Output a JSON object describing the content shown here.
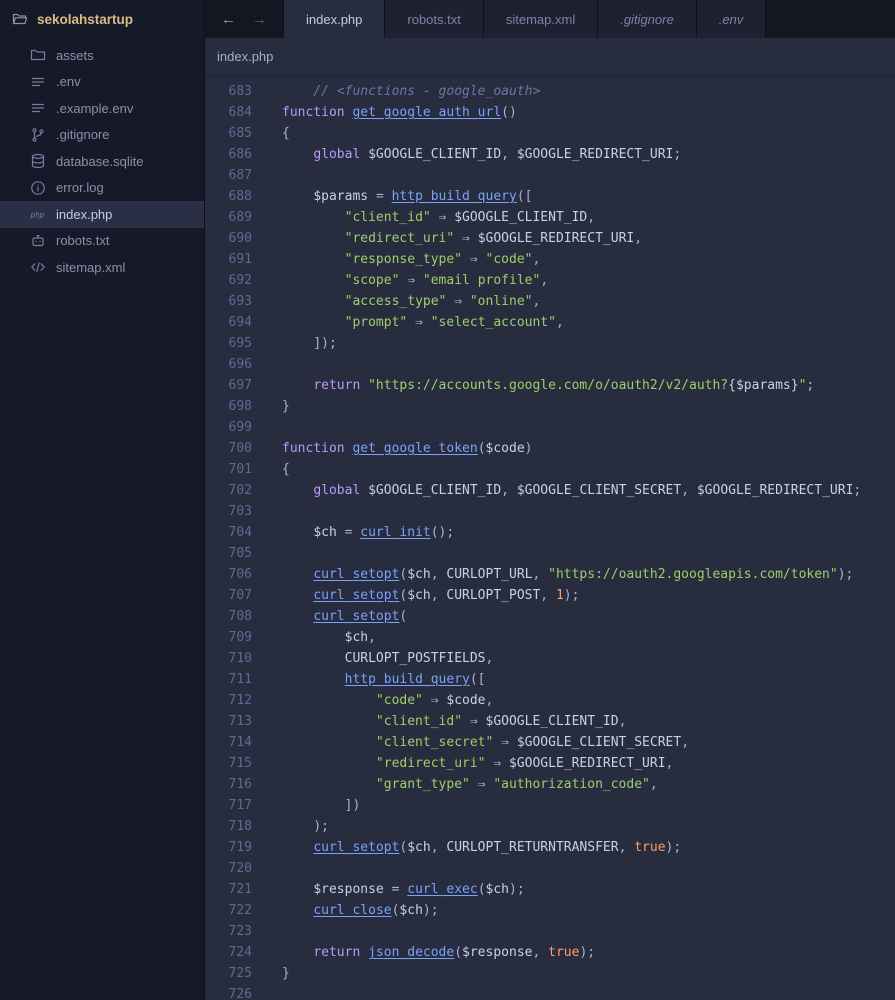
{
  "workspace": {
    "name": "sekolahstartup"
  },
  "sidebar": {
    "files": [
      {
        "name": "assets",
        "icon": "folder"
      },
      {
        "name": ".env",
        "icon": "list"
      },
      {
        "name": ".example.env",
        "icon": "list"
      },
      {
        "name": ".gitignore",
        "icon": "git-branch"
      },
      {
        "name": "database.sqlite",
        "icon": "database"
      },
      {
        "name": "error.log",
        "icon": "info"
      },
      {
        "name": "index.php",
        "icon": "php",
        "selected": true
      },
      {
        "name": "robots.txt",
        "icon": "robot"
      },
      {
        "name": "sitemap.xml",
        "icon": "code"
      }
    ]
  },
  "tabbar": {
    "back": "←",
    "forward": "→",
    "tabs": [
      {
        "label": "index.php",
        "active": true
      },
      {
        "label": "robots.txt"
      },
      {
        "label": "sitemap.xml"
      },
      {
        "label": ".gitignore",
        "italic": true
      },
      {
        "label": ".env",
        "italic": true
      }
    ]
  },
  "breadcrumb": {
    "path": "index.php"
  },
  "colors": {
    "editor_bg": "#272c3f",
    "sidebar_bg": "#161a28",
    "tabbar_bg": "#141722",
    "tab_inactive_bg": "#1d2130",
    "selected_file_bg": "#2a2f45",
    "keyword": "#bb9af7",
    "function": "#7aa2f7",
    "string": "#9ece6a",
    "variable": "#c9cfe9",
    "comment": "#6d75a3",
    "punctuation": "#a9b1d6",
    "number": "#ff9e64",
    "boolean": "#ff9e64",
    "arrow": "#b6bedd",
    "line_number": "#5f6a94",
    "accent_folder": "#d9bd84"
  },
  "editor": {
    "lines": [
      {
        "n": 683,
        "t": [
          [
            "pln",
            "    "
          ],
          [
            "cmt",
            "// <functions - google_oauth>"
          ]
        ]
      },
      {
        "n": 684,
        "t": [
          [
            "kw",
            "function"
          ],
          [
            "pln",
            " "
          ],
          [
            "fn",
            "get_google_auth_url"
          ],
          [
            "pun",
            "()"
          ]
        ]
      },
      {
        "n": 685,
        "t": [
          [
            "pun",
            "{"
          ]
        ]
      },
      {
        "n": 686,
        "t": [
          [
            "pln",
            "    "
          ],
          [
            "kw",
            "global"
          ],
          [
            "pln",
            " "
          ],
          [
            "var",
            "$GOOGLE_CLIENT_ID"
          ],
          [
            "pun",
            ","
          ],
          [
            "pln",
            " "
          ],
          [
            "var",
            "$GOOGLE_REDIRECT_URI"
          ],
          [
            "pun",
            ";"
          ]
        ]
      },
      {
        "n": 687,
        "t": []
      },
      {
        "n": 688,
        "t": [
          [
            "pln",
            "    "
          ],
          [
            "var",
            "$params"
          ],
          [
            "pln",
            " "
          ],
          [
            "pun",
            "="
          ],
          [
            "pln",
            " "
          ],
          [
            "fn",
            "http_build_query"
          ],
          [
            "pun",
            "(["
          ]
        ]
      },
      {
        "n": 689,
        "t": [
          [
            "pln",
            "        "
          ],
          [
            "str",
            "\"client_id\""
          ],
          [
            "pln",
            " "
          ],
          [
            "arr",
            "⇒"
          ],
          [
            "pln",
            " "
          ],
          [
            "var",
            "$GOOGLE_CLIENT_ID"
          ],
          [
            "pun",
            ","
          ]
        ]
      },
      {
        "n": 690,
        "t": [
          [
            "pln",
            "        "
          ],
          [
            "str",
            "\"redirect_uri\""
          ],
          [
            "pln",
            " "
          ],
          [
            "arr",
            "⇒"
          ],
          [
            "pln",
            " "
          ],
          [
            "var",
            "$GOOGLE_REDIRECT_URI"
          ],
          [
            "pun",
            ","
          ]
        ]
      },
      {
        "n": 691,
        "t": [
          [
            "pln",
            "        "
          ],
          [
            "str",
            "\"response_type\""
          ],
          [
            "pln",
            " "
          ],
          [
            "arr",
            "⇒"
          ],
          [
            "pln",
            " "
          ],
          [
            "str",
            "\"code\""
          ],
          [
            "pun",
            ","
          ]
        ]
      },
      {
        "n": 692,
        "t": [
          [
            "pln",
            "        "
          ],
          [
            "str",
            "\"scope\""
          ],
          [
            "pln",
            " "
          ],
          [
            "arr",
            "⇒"
          ],
          [
            "pln",
            " "
          ],
          [
            "str",
            "\"email profile\""
          ],
          [
            "pun",
            ","
          ]
        ]
      },
      {
        "n": 693,
        "t": [
          [
            "pln",
            "        "
          ],
          [
            "str",
            "\"access_type\""
          ],
          [
            "pln",
            " "
          ],
          [
            "arr",
            "⇒"
          ],
          [
            "pln",
            " "
          ],
          [
            "str",
            "\"online\""
          ],
          [
            "pun",
            ","
          ]
        ]
      },
      {
        "n": 694,
        "t": [
          [
            "pln",
            "        "
          ],
          [
            "str",
            "\"prompt\""
          ],
          [
            "pln",
            " "
          ],
          [
            "arr",
            "⇒"
          ],
          [
            "pln",
            " "
          ],
          [
            "str",
            "\"select_account\""
          ],
          [
            "pun",
            ","
          ]
        ]
      },
      {
        "n": 695,
        "t": [
          [
            "pln",
            "    "
          ],
          [
            "pun",
            "]);"
          ]
        ]
      },
      {
        "n": 696,
        "t": []
      },
      {
        "n": 697,
        "t": [
          [
            "pln",
            "    "
          ],
          [
            "kw",
            "return"
          ],
          [
            "pln",
            " "
          ],
          [
            "str",
            "\"https://accounts.google.com/o/oauth2/v2/auth?"
          ],
          [
            "interp",
            "{$params}"
          ],
          [
            "str",
            "\""
          ],
          [
            "pun",
            ";"
          ]
        ]
      },
      {
        "n": 698,
        "t": [
          [
            "pun",
            "}"
          ]
        ]
      },
      {
        "n": 699,
        "t": []
      },
      {
        "n": 700,
        "t": [
          [
            "kw",
            "function"
          ],
          [
            "pln",
            " "
          ],
          [
            "fn",
            "get_google_token"
          ],
          [
            "pun",
            "("
          ],
          [
            "var",
            "$code"
          ],
          [
            "pun",
            ")"
          ]
        ]
      },
      {
        "n": 701,
        "t": [
          [
            "pun",
            "{"
          ]
        ]
      },
      {
        "n": 702,
        "t": [
          [
            "pln",
            "    "
          ],
          [
            "kw",
            "global"
          ],
          [
            "pln",
            " "
          ],
          [
            "var",
            "$GOOGLE_CLIENT_ID"
          ],
          [
            "pun",
            ","
          ],
          [
            "pln",
            " "
          ],
          [
            "var",
            "$GOOGLE_CLIENT_SECRET"
          ],
          [
            "pun",
            ","
          ],
          [
            "pln",
            " "
          ],
          [
            "var",
            "$GOOGLE_REDIRECT_URI"
          ],
          [
            "pun",
            ";"
          ]
        ]
      },
      {
        "n": 703,
        "t": []
      },
      {
        "n": 704,
        "t": [
          [
            "pln",
            "    "
          ],
          [
            "var",
            "$ch"
          ],
          [
            "pln",
            " "
          ],
          [
            "pun",
            "="
          ],
          [
            "pln",
            " "
          ],
          [
            "fn",
            "curl_init"
          ],
          [
            "pun",
            "();"
          ]
        ]
      },
      {
        "n": 705,
        "t": []
      },
      {
        "n": 706,
        "t": [
          [
            "pln",
            "    "
          ],
          [
            "fn",
            "curl_setopt"
          ],
          [
            "pun",
            "("
          ],
          [
            "var",
            "$ch"
          ],
          [
            "pun",
            ","
          ],
          [
            "pln",
            " "
          ],
          [
            "const",
            "CURLOPT_URL"
          ],
          [
            "pun",
            ","
          ],
          [
            "pln",
            " "
          ],
          [
            "str",
            "\"https://oauth2.googleapis.com/token\""
          ],
          [
            "pun",
            ");"
          ]
        ]
      },
      {
        "n": 707,
        "t": [
          [
            "pln",
            "    "
          ],
          [
            "fn",
            "curl_setopt"
          ],
          [
            "pun",
            "("
          ],
          [
            "var",
            "$ch"
          ],
          [
            "pun",
            ","
          ],
          [
            "pln",
            " "
          ],
          [
            "const",
            "CURLOPT_POST"
          ],
          [
            "pun",
            ","
          ],
          [
            "pln",
            " "
          ],
          [
            "num",
            "1"
          ],
          [
            "pun",
            ");"
          ]
        ]
      },
      {
        "n": 708,
        "t": [
          [
            "pln",
            "    "
          ],
          [
            "fn",
            "curl_setopt"
          ],
          [
            "pun",
            "("
          ]
        ]
      },
      {
        "n": 709,
        "t": [
          [
            "pln",
            "        "
          ],
          [
            "var",
            "$ch"
          ],
          [
            "pun",
            ","
          ]
        ]
      },
      {
        "n": 710,
        "t": [
          [
            "pln",
            "        "
          ],
          [
            "const",
            "CURLOPT_POSTFIELDS"
          ],
          [
            "pun",
            ","
          ]
        ]
      },
      {
        "n": 711,
        "t": [
          [
            "pln",
            "        "
          ],
          [
            "fn",
            "http_build_query"
          ],
          [
            "pun",
            "(["
          ]
        ]
      },
      {
        "n": 712,
        "t": [
          [
            "pln",
            "            "
          ],
          [
            "str",
            "\"code\""
          ],
          [
            "pln",
            " "
          ],
          [
            "arr",
            "⇒"
          ],
          [
            "pln",
            " "
          ],
          [
            "var",
            "$code"
          ],
          [
            "pun",
            ","
          ]
        ]
      },
      {
        "n": 713,
        "t": [
          [
            "pln",
            "            "
          ],
          [
            "str",
            "\"client_id\""
          ],
          [
            "pln",
            " "
          ],
          [
            "arr",
            "⇒"
          ],
          [
            "pln",
            " "
          ],
          [
            "var",
            "$GOOGLE_CLIENT_ID"
          ],
          [
            "pun",
            ","
          ]
        ]
      },
      {
        "n": 714,
        "t": [
          [
            "pln",
            "            "
          ],
          [
            "str",
            "\"client_secret\""
          ],
          [
            "pln",
            " "
          ],
          [
            "arr",
            "⇒"
          ],
          [
            "pln",
            " "
          ],
          [
            "var",
            "$GOOGLE_CLIENT_SECRET"
          ],
          [
            "pun",
            ","
          ]
        ]
      },
      {
        "n": 715,
        "t": [
          [
            "pln",
            "            "
          ],
          [
            "str",
            "\"redirect_uri\""
          ],
          [
            "pln",
            " "
          ],
          [
            "arr",
            "⇒"
          ],
          [
            "pln",
            " "
          ],
          [
            "var",
            "$GOOGLE_REDIRECT_URI"
          ],
          [
            "pun",
            ","
          ]
        ]
      },
      {
        "n": 716,
        "t": [
          [
            "pln",
            "            "
          ],
          [
            "str",
            "\"grant_type\""
          ],
          [
            "pln",
            " "
          ],
          [
            "arr",
            "⇒"
          ],
          [
            "pln",
            " "
          ],
          [
            "str",
            "\"authorization_code\""
          ],
          [
            "pun",
            ","
          ]
        ]
      },
      {
        "n": 717,
        "t": [
          [
            "pln",
            "        "
          ],
          [
            "pun",
            "])"
          ]
        ]
      },
      {
        "n": 718,
        "t": [
          [
            "pln",
            "    "
          ],
          [
            "pun",
            ");"
          ]
        ]
      },
      {
        "n": 719,
        "t": [
          [
            "pln",
            "    "
          ],
          [
            "fn",
            "curl_setopt"
          ],
          [
            "pun",
            "("
          ],
          [
            "var",
            "$ch"
          ],
          [
            "pun",
            ","
          ],
          [
            "pln",
            " "
          ],
          [
            "const",
            "CURLOPT_RETURNTRANSFER"
          ],
          [
            "pun",
            ","
          ],
          [
            "pln",
            " "
          ],
          [
            "bool",
            "true"
          ],
          [
            "pun",
            ");"
          ]
        ]
      },
      {
        "n": 720,
        "t": []
      },
      {
        "n": 721,
        "t": [
          [
            "pln",
            "    "
          ],
          [
            "var",
            "$response"
          ],
          [
            "pln",
            " "
          ],
          [
            "pun",
            "="
          ],
          [
            "pln",
            " "
          ],
          [
            "fn",
            "curl_exec"
          ],
          [
            "pun",
            "("
          ],
          [
            "var",
            "$ch"
          ],
          [
            "pun",
            ");"
          ]
        ]
      },
      {
        "n": 722,
        "t": [
          [
            "pln",
            "    "
          ],
          [
            "fn",
            "curl_close"
          ],
          [
            "pun",
            "("
          ],
          [
            "var",
            "$ch"
          ],
          [
            "pun",
            ");"
          ]
        ]
      },
      {
        "n": 723,
        "t": []
      },
      {
        "n": 724,
        "t": [
          [
            "pln",
            "    "
          ],
          [
            "kw",
            "return"
          ],
          [
            "pln",
            " "
          ],
          [
            "fn",
            "json_decode"
          ],
          [
            "pun",
            "("
          ],
          [
            "var",
            "$response"
          ],
          [
            "pun",
            ","
          ],
          [
            "pln",
            " "
          ],
          [
            "bool",
            "true"
          ],
          [
            "pun",
            ");"
          ]
        ]
      },
      {
        "n": 725,
        "t": [
          [
            "pun",
            "}"
          ]
        ]
      },
      {
        "n": 726,
        "t": []
      }
    ]
  }
}
